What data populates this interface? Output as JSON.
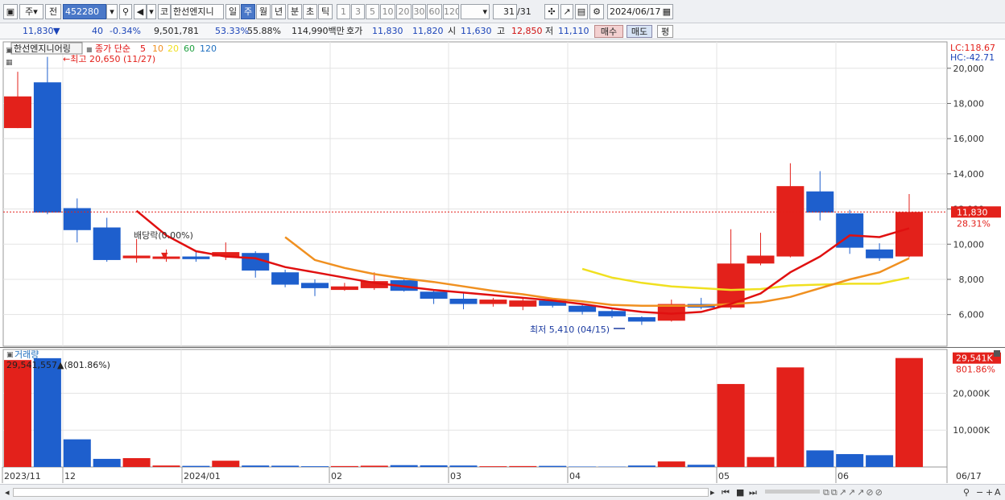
{
  "toolbar": {
    "market": "주",
    "prev": "전",
    "code": "452280",
    "name_prefix": "코",
    "stock_name": "한선엔지니",
    "periods": [
      "일",
      "주",
      "월",
      "년",
      "분",
      "초",
      "틱"
    ],
    "active_period": "주",
    "intervals": [
      "1",
      "3",
      "5",
      "10",
      "20",
      "30",
      "60",
      "120"
    ],
    "page_current": "31",
    "page_total": "/31",
    "date": "2024/06/17"
  },
  "info": {
    "price": "11,830",
    "arrow": "▼",
    "change": "40",
    "change_pct": "-0.34%",
    "volume": "9,501,781",
    "ratio1": "53.33%",
    "ratio2": "55.88%",
    "amount": "114,990백만",
    "hoga_label": "호가",
    "ask": "11,830",
    "bid": "11,820",
    "open_label": "시",
    "open": "11,630",
    "high_label": "고",
    "high": "12,850",
    "low_label": "저",
    "low": "11,110",
    "buy": "매수",
    "sell": "매도",
    "eval": "평"
  },
  "legend": {
    "stock": "한선엔지니어링",
    "ma_title": "종가 단순",
    "ma": [
      {
        "label": "5",
        "color": "#e01010"
      },
      {
        "label": "10",
        "color": "#f09020"
      },
      {
        "label": "20",
        "color": "#f0e020"
      },
      {
        "label": "60",
        "color": "#20a040"
      },
      {
        "label": "120",
        "color": "#2070c0"
      }
    ]
  },
  "annotations": {
    "high_note": "←최고 20,650 (11/27)",
    "low_note": "최저 5,410 (04/15)",
    "dividend_note": "배당락(0.00%)"
  },
  "right_axis": {
    "lc": "LC:118.67",
    "hc": "HC:-42.71",
    "price_labels": [
      "20,000",
      "18,000",
      "16,000",
      "14,000",
      "12,000",
      "10,000",
      "8,000",
      "6,000"
    ],
    "current_price": "11,830",
    "current_pct": "28.31%",
    "vol_labels": [
      "20,000K",
      "10,000K"
    ],
    "current_vol": "29,541K",
    "current_vol_pct": "801.86%"
  },
  "volume_panel": {
    "title": "거래량",
    "value_note": "29,541,557▲(801.86%)"
  },
  "x_axis": {
    "labels": [
      "2023/11",
      "12",
      "2024/01",
      "02",
      "03",
      "04",
      "05",
      "06",
      "06/17"
    ]
  },
  "colors": {
    "up": "#e3211b",
    "down": "#1e5fcd",
    "ma5": "#e01010",
    "ma10": "#f09020",
    "ma20": "#f0e020"
  },
  "chart_data": {
    "type": "candlestick",
    "period": "weekly",
    "candles": [
      {
        "o": 16600,
        "h": 19800,
        "l": 16600,
        "c": 18400,
        "up": true
      },
      {
        "o": 19200,
        "h": 20650,
        "l": 11700,
        "c": 11800,
        "up": false
      },
      {
        "o": 12050,
        "h": 12600,
        "l": 10100,
        "c": 10800,
        "up": false
      },
      {
        "o": 10950,
        "h": 11500,
        "l": 9000,
        "c": 9100,
        "up": false
      },
      {
        "o": 9200,
        "h": 10300,
        "l": 8950,
        "c": 9350,
        "up": true
      },
      {
        "o": 9180,
        "h": 9700,
        "l": 9000,
        "c": 9300,
        "up": true
      },
      {
        "o": 9300,
        "h": 9600,
        "l": 9000,
        "c": 9150,
        "up": false
      },
      {
        "o": 9300,
        "h": 10100,
        "l": 9100,
        "c": 9550,
        "up": true
      },
      {
        "o": 9500,
        "h": 9600,
        "l": 8100,
        "c": 8500,
        "up": false
      },
      {
        "o": 8400,
        "h": 8550,
        "l": 7550,
        "c": 7700,
        "up": false
      },
      {
        "o": 7800,
        "h": 8000,
        "l": 7050,
        "c": 7500,
        "up": false
      },
      {
        "o": 7400,
        "h": 7800,
        "l": 7350,
        "c": 7600,
        "up": true
      },
      {
        "o": 7500,
        "h": 8400,
        "l": 7400,
        "c": 7900,
        "up": true
      },
      {
        "o": 7950,
        "h": 8000,
        "l": 7300,
        "c": 7350,
        "up": false
      },
      {
        "o": 7300,
        "h": 7450,
        "l": 6600,
        "c": 6900,
        "up": false
      },
      {
        "o": 6900,
        "h": 7200,
        "l": 6300,
        "c": 6600,
        "up": false
      },
      {
        "o": 6600,
        "h": 6950,
        "l": 6450,
        "c": 6850,
        "up": true
      },
      {
        "o": 6800,
        "h": 6950,
        "l": 6250,
        "c": 6450,
        "up": true
      },
      {
        "o": 6800,
        "h": 6950,
        "l": 6400,
        "c": 6500,
        "up": false
      },
      {
        "o": 6500,
        "h": 6650,
        "l": 6000,
        "c": 6150,
        "up": false
      },
      {
        "o": 6200,
        "h": 6300,
        "l": 5800,
        "c": 5900,
        "up": false
      },
      {
        "o": 5850,
        "h": 5900,
        "l": 5410,
        "c": 5600,
        "up": false
      },
      {
        "o": 5650,
        "h": 6850,
        "l": 5600,
        "c": 6600,
        "up": true
      },
      {
        "o": 6600,
        "h": 6950,
        "l": 6300,
        "c": 6400,
        "up": false
      },
      {
        "o": 6400,
        "h": 10850,
        "l": 6300,
        "c": 8900,
        "up": true
      },
      {
        "o": 8900,
        "h": 10650,
        "l": 8800,
        "c": 9350,
        "up": true
      },
      {
        "o": 9300,
        "h": 14600,
        "l": 9250,
        "c": 13300,
        "up": true
      },
      {
        "o": 13000,
        "h": 14150,
        "l": 11350,
        "c": 11800,
        "up": false
      },
      {
        "o": 11750,
        "h": 11950,
        "l": 9450,
        "c": 9800,
        "up": false
      },
      {
        "o": 9700,
        "h": 10050,
        "l": 9050,
        "c": 9200,
        "up": false
      },
      {
        "o": 9300,
        "h": 12850,
        "l": 9250,
        "c": 11830,
        "up": true
      }
    ],
    "ma5": [
      null,
      null,
      null,
      null,
      11900,
      10500,
      9600,
      9300,
      9200,
      8700,
      8400,
      8100,
      7800,
      7600,
      7400,
      7250,
      7100,
      6950,
      6800,
      6600,
      6350,
      6150,
      6050,
      6150,
      6600,
      7200,
      8400,
      9300,
      10500,
      10400,
      10900
    ],
    "ma10": [
      null,
      null,
      null,
      null,
      null,
      null,
      null,
      null,
      null,
      10400,
      9100,
      8650,
      8300,
      8050,
      7850,
      7600,
      7350,
      7150,
      6900,
      6750,
      6550,
      6500,
      6500,
      6500,
      6600,
      6700,
      7000,
      7500,
      8000,
      8400,
      9200
    ],
    "ma20": [
      null,
      null,
      null,
      null,
      null,
      null,
      null,
      null,
      null,
      null,
      null,
      null,
      null,
      null,
      null,
      null,
      null,
      null,
      null,
      8600,
      8100,
      7800,
      7600,
      7500,
      7400,
      7450,
      7650,
      7700,
      7750,
      7750,
      8100
    ],
    "volume_k": [
      29000,
      29500,
      7500,
      2200,
      2400,
      400,
      300,
      1700,
      400,
      350,
      200,
      250,
      350,
      500,
      450,
      400,
      200,
      250,
      300,
      120,
      100,
      400,
      1500,
      600,
      22500,
      2700,
      27000,
      4500,
      3500,
      3200,
      29541
    ],
    "ylim": [
      4200,
      21500
    ],
    "vol_ylim": [
      0,
      31000
    ]
  }
}
